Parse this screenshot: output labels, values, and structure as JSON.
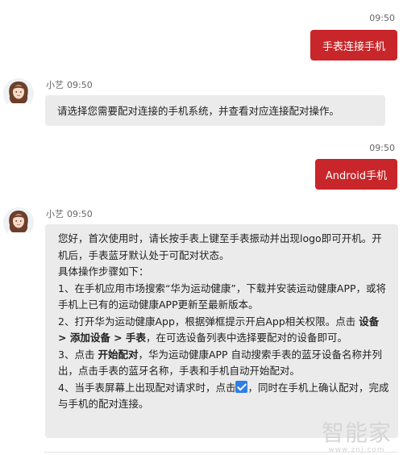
{
  "messages": [
    {
      "sender": "user",
      "time": "09:50",
      "text": "手表连接手机"
    },
    {
      "sender": "assistant",
      "name": "小艺",
      "time": "09:50",
      "text": "请选择您需要配对连接的手机系统，并查看对应连接配对操作。"
    },
    {
      "sender": "user",
      "time": "09:50",
      "text": "Android手机"
    },
    {
      "sender": "assistant",
      "name": "小艺",
      "time": "09:50",
      "line1": "您好，首次使用时，请长按手表上键至手表振动并出现logo即可开机。开机后，手表蓝牙默认处于可配对状态。",
      "line2": "具体操作步骤如下：",
      "step1": "1、在手机应用市场搜索“华为运动健康”，下载并安装运动健康APP，或将手机上已有的运动健康APP更新至最新版本。",
      "step2_a": "2、打开华为运动健康App，根据弹框提示开启App相关权限。点击 ",
      "step2_b": "设备 > 添加设备 > 手表",
      "step2_c": "，在可选设备列表中选择要配对的设备即可。",
      "step3_a": "3、点击 ",
      "step3_b": "开始配对",
      "step3_c": "，华为运动健康APP 自动搜索手表的蓝牙设备名称并列出，点击手表的蓝牙名称，手表和手机自动开始配对。",
      "step4_a": "4、当手表屏幕上出现配对请求时，点击",
      "step4_b": "，同时在手机上确认配对，完成与手机的配对连接。"
    }
  ],
  "watermark": {
    "text": "智能家",
    "url": "www.znj.com"
  },
  "icons": {
    "avatar": "assistant-avatar-icon",
    "check": "checkmark-icon"
  }
}
